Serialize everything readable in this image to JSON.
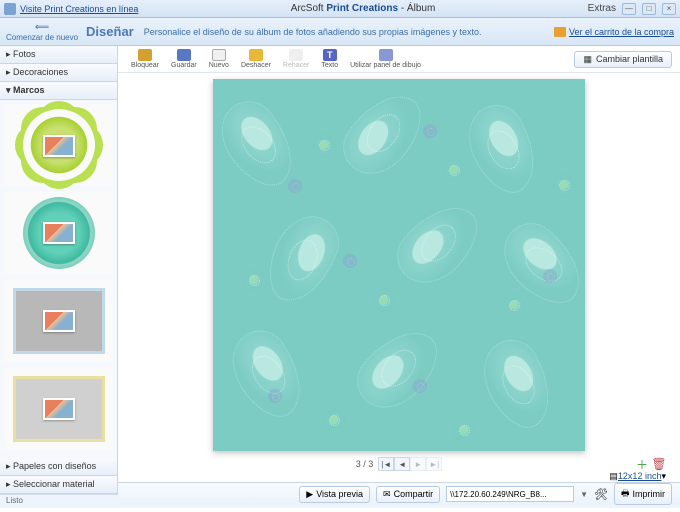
{
  "titlebar": {
    "link": "Visite Print Creations en línea",
    "app_brand": "ArcSoft",
    "app_name": "Print Creations",
    "app_suffix": "- Álbum",
    "extras": "Extras"
  },
  "header": {
    "back": "Comenzar de nuevo",
    "title": "Diseñar",
    "subtitle": "Personalice el diseño de su álbum de fotos añadiendo sus propias imágenes y texto.",
    "cart": "Ver el carrito de la compra"
  },
  "sidebar": {
    "sections": {
      "fotos": "Fotos",
      "decoraciones": "Decoraciones",
      "marcos": "Marcos",
      "papeles": "Papeles con diseños",
      "material": "Seleccionar material"
    }
  },
  "toolbar": {
    "bloquear": "Bloquear",
    "guardar": "Guardar",
    "nuevo": "Nuevo",
    "deshacer": "Deshacer",
    "rehacer": "Rehacer",
    "texto": "Texto",
    "panel": "Utilizar panel de dibujo",
    "cambiar": "Cambiar plantilla"
  },
  "pager": {
    "label": "3 / 3",
    "size": "12x12 inch"
  },
  "footer": {
    "preview": "Vista previa",
    "share": "Compartir",
    "printer": "\\\\172.20.60.249\\NRG_B8...",
    "print": "Imprimir"
  },
  "status": "Listo"
}
